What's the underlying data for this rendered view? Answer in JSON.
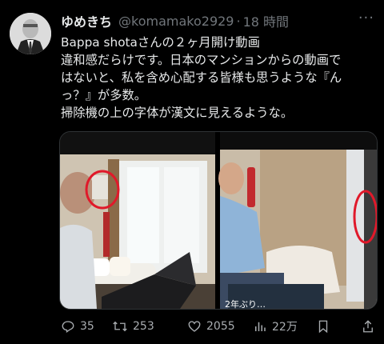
{
  "tweet": {
    "display_name": "ゆめきち",
    "handle": "@komamako2929",
    "separator": "·",
    "time": "18 時間",
    "lines": [
      "Bappa shotaさんの２ヶ月開け動画",
      "違和感だらけです。日本のマンションからの動画で",
      "はないと、私を含め心配する皆様も思うような『ん",
      "っ？』が多数。",
      "掃除機の上の字体が漢文に見えるような。"
    ]
  },
  "media": {
    "left_caption": "",
    "right_caption": "2年ぶり…",
    "circle_color": "#e0192a"
  },
  "actions": {
    "replies": "35",
    "retweets": "253",
    "likes": "2055",
    "views": "22万"
  }
}
